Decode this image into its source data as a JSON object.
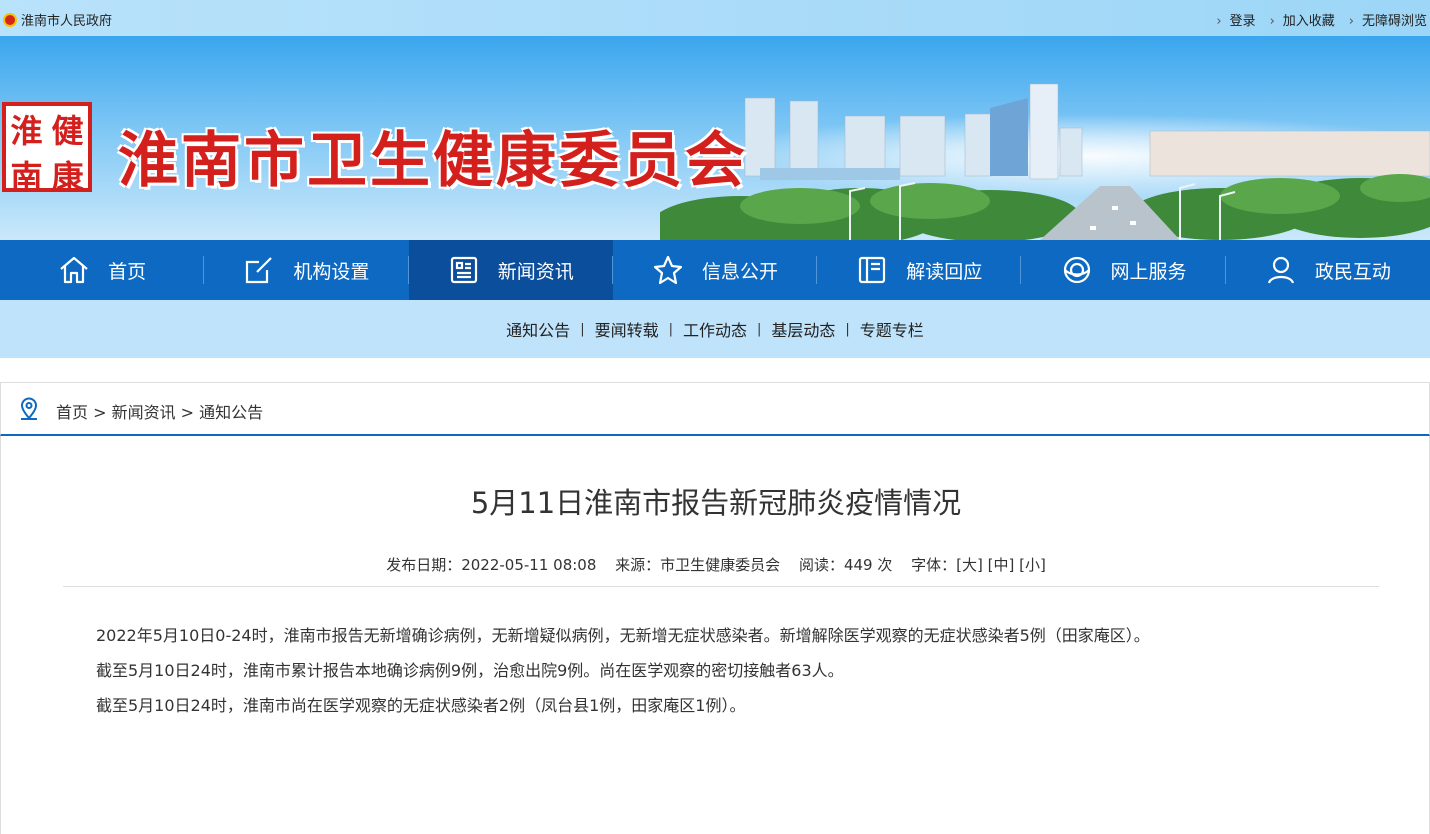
{
  "topbar": {
    "site_name": "淮南市人民政府",
    "links": [
      "登录",
      "加入收藏",
      "无障碍浏览"
    ]
  },
  "banner": {
    "seal_chars": [
      "淮",
      "健",
      "南",
      "康"
    ],
    "title": "淮南市卫生健康委员会"
  },
  "main_nav": [
    {
      "label": "首页",
      "icon": "home-icon"
    },
    {
      "label": "机构设置",
      "icon": "edit-icon"
    },
    {
      "label": "新闻资讯",
      "icon": "news-icon",
      "active": true
    },
    {
      "label": "信息公开",
      "icon": "star-icon"
    },
    {
      "label": "解读回应",
      "icon": "book-icon"
    },
    {
      "label": "网上服务",
      "icon": "globe-icon"
    },
    {
      "label": "政民互动",
      "icon": "user-icon"
    }
  ],
  "sub_nav": [
    "通知公告",
    "要闻转载",
    "工作动态",
    "基层动态",
    "专题专栏"
  ],
  "breadcrumb": {
    "text": "首页 > 新闻资讯 > 通知公告"
  },
  "article": {
    "title": "5月11日淮南市报告新冠肺炎疫情情况",
    "date": "发布日期：2022-05-11 08:08",
    "source": "来源：市卫生健康委员会",
    "reads": "阅读：449 次",
    "font_size": "字体：[大] [中] [小]",
    "paragraphs": [
      "2022年5月10日0-24时，淮南市报告无新增确诊病例，无新增疑似病例，无新增无症状感染者。新增解除医学观察的无症状感染者5例（田家庵区）。",
      "截至5月10日24时，淮南市累计报告本地确诊病例9例，治愈出院9例。尚在医学观察的密切接触者63人。",
      "截至5月10日24时，淮南市尚在医学观察的无症状感染者2例（凤台县1例，田家庵区1例）。"
    ]
  },
  "colors": {
    "nav_blue": "#0d69c1",
    "nav_active": "#0a4e9c",
    "subnav_bg": "#bfe3fa",
    "title_red": "#d3201d"
  }
}
